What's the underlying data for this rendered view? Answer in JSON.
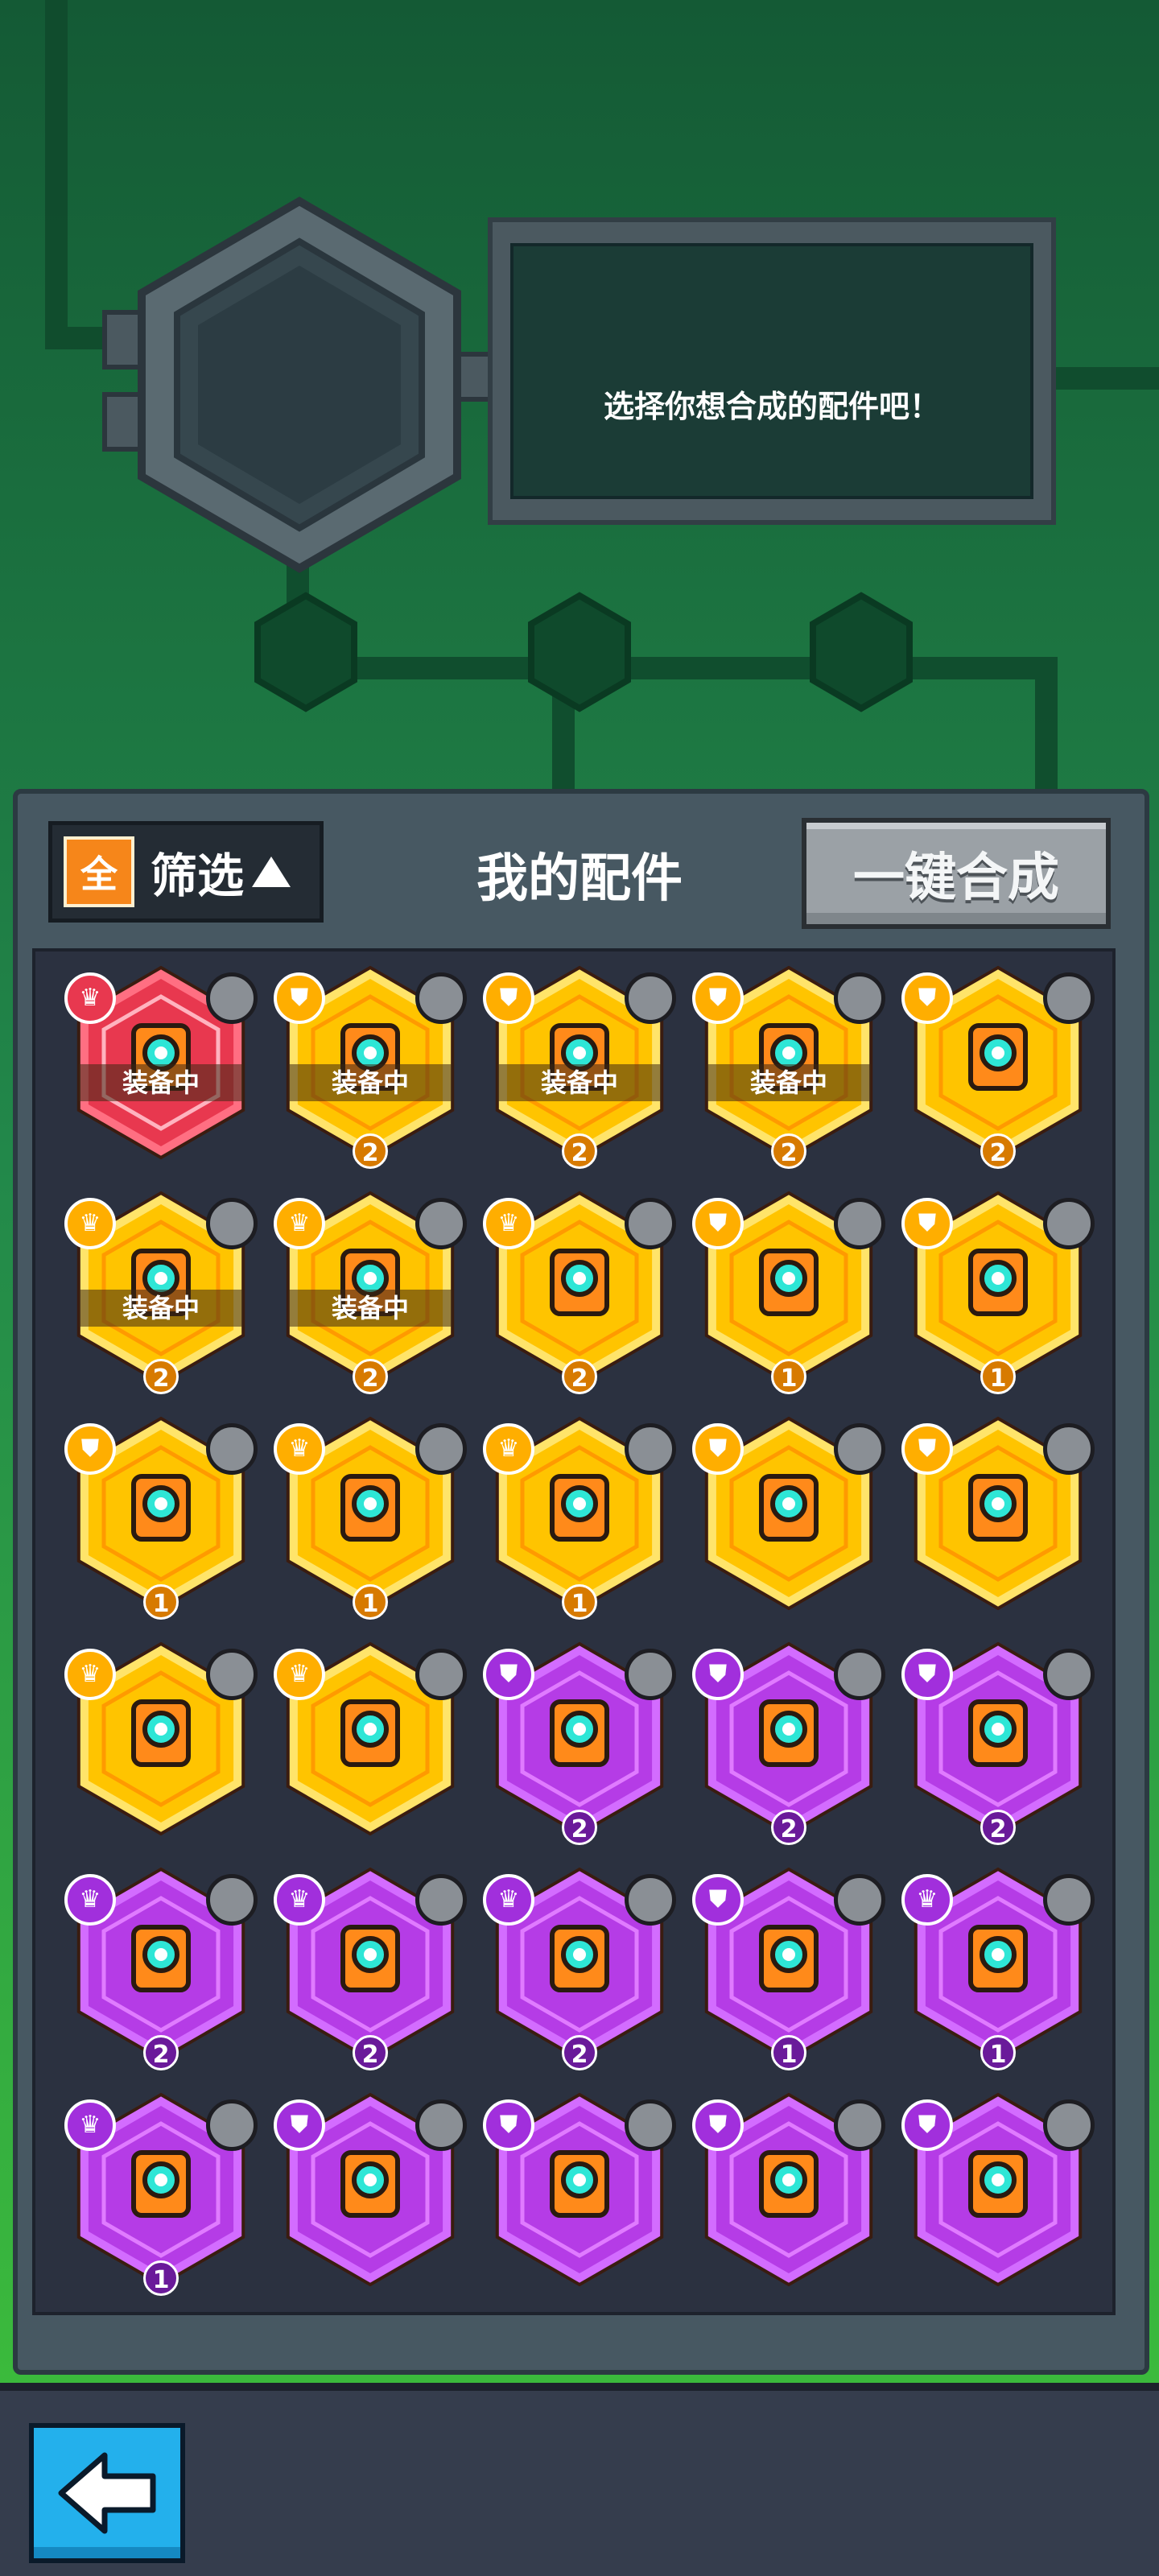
{
  "header": {
    "prompt_text": "选择你想合成的配件吧！"
  },
  "panel": {
    "filter_badge": "全",
    "filter_label": "筛选",
    "title": "我的配件",
    "merge_button": "一键合成"
  },
  "colors": {
    "legendary_red": "#e8384f",
    "epic_gold": "#ffc400",
    "rare_purple": "#b53ce6",
    "accent_orange": "#f6861a",
    "back_button": "#23b0ec"
  },
  "parts": [
    {
      "rarity": "red",
      "part": "eye-turret-icon",
      "role": "crown",
      "sub": "camera-icon",
      "equipped": "装备中",
      "level": ""
    },
    {
      "rarity": "gold",
      "part": "boot-armor-icon",
      "role": "shield",
      "sub": "watermelon-icon",
      "equipped": "装备中",
      "level": "2"
    },
    {
      "rarity": "gold",
      "part": "belt-armor-icon",
      "role": "shield",
      "sub": "target-icon",
      "equipped": "装备中",
      "level": "2"
    },
    {
      "rarity": "gold",
      "part": "helmet-icon",
      "role": "shield",
      "sub": "brick-icon",
      "equipped": "装备中",
      "level": "2"
    },
    {
      "rarity": "gold",
      "part": "speaker-icon",
      "role": "shield",
      "sub": "boomerang-icon",
      "equipped": "",
      "level": "2"
    },
    {
      "rarity": "gold",
      "part": "printer-body-icon",
      "role": "crown",
      "sub": "cone-icon",
      "equipped": "装备中",
      "level": "2"
    },
    {
      "rarity": "gold",
      "part": "lens-core-icon",
      "role": "crown",
      "sub": "soccer-ball-icon",
      "equipped": "装备中",
      "level": "2"
    },
    {
      "rarity": "gold",
      "part": "triangle-core-icon",
      "role": "crown",
      "sub": "bottle-icon",
      "equipped": "",
      "level": "2"
    },
    {
      "rarity": "gold",
      "part": "shoulder-plate-icon",
      "role": "shield",
      "sub": "rocket-icon",
      "equipped": "",
      "level": "1"
    },
    {
      "rarity": "gold",
      "part": "head-unit-icon",
      "role": "shield",
      "sub": "brick-icon",
      "equipped": "",
      "level": "1"
    },
    {
      "rarity": "gold",
      "part": "walker-drone-icon",
      "role": "shield",
      "sub": "spiky-ball-icon",
      "equipped": "",
      "level": "1"
    },
    {
      "rarity": "gold",
      "part": "turret-base-icon",
      "role": "crown",
      "sub": "drill-icon",
      "equipped": "",
      "level": "1"
    },
    {
      "rarity": "gold",
      "part": "leg-armor-icon",
      "role": "crown",
      "sub": "dice-icon",
      "equipped": "",
      "level": "1"
    },
    {
      "rarity": "gold",
      "part": "shoulder-plate-icon",
      "role": "shield",
      "sub": "rocket-icon",
      "equipped": "",
      "level": ""
    },
    {
      "rarity": "gold",
      "part": "walker-drone-icon",
      "role": "shield",
      "sub": "spiky-ball-icon",
      "equipped": "",
      "level": ""
    },
    {
      "rarity": "gold",
      "part": "printer-body-icon",
      "role": "crown",
      "sub": "cone-icon",
      "equipped": "",
      "level": ""
    },
    {
      "rarity": "gold",
      "part": "leg-armor-icon",
      "role": "crown",
      "sub": "dice-icon",
      "equipped": "",
      "level": ""
    },
    {
      "rarity": "purple",
      "part": "chest-plate-icon",
      "role": "shield",
      "sub": "rocket-icon",
      "equipped": "",
      "level": "2"
    },
    {
      "rarity": "purple",
      "part": "capsule-icon",
      "role": "shield",
      "sub": "watermelon-icon",
      "equipped": "",
      "level": "2"
    },
    {
      "rarity": "purple",
      "part": "monitor-bot-icon",
      "role": "shield",
      "sub": "brick-icon",
      "equipped": "",
      "level": "2"
    },
    {
      "rarity": "purple",
      "part": "cannon-mount-icon",
      "role": "crown",
      "sub": "drill-icon",
      "equipped": "",
      "level": "2"
    },
    {
      "rarity": "purple",
      "part": "lens-core-icon",
      "role": "crown",
      "sub": "soccer-ball-icon",
      "equipped": "",
      "level": "2"
    },
    {
      "rarity": "purple",
      "part": "leg-armor-icon",
      "role": "crown",
      "sub": "dice-icon",
      "equipped": "",
      "level": "2"
    },
    {
      "rarity": "purple",
      "part": "speaker-icon",
      "role": "shield",
      "sub": "boomerang-icon",
      "equipped": "",
      "level": "1"
    },
    {
      "rarity": "purple",
      "part": "cannon-mount-icon",
      "role": "crown",
      "sub": "drill-icon",
      "equipped": "",
      "level": "1"
    },
    {
      "rarity": "purple",
      "part": "lens-core-icon",
      "role": "crown",
      "sub": "soccer-ball-icon",
      "equipped": "",
      "level": "1"
    },
    {
      "rarity": "purple",
      "part": "chest-plate-icon",
      "role": "shield",
      "sub": "rocket-icon",
      "equipped": "",
      "level": ""
    },
    {
      "rarity": "purple",
      "part": "capsule-icon",
      "role": "shield",
      "sub": "watermelon-icon",
      "equipped": "",
      "level": ""
    },
    {
      "rarity": "purple",
      "part": "monitor-bot-icon",
      "role": "shield",
      "sub": "brick-icon",
      "equipped": "",
      "level": ""
    },
    {
      "rarity": "purple",
      "part": "speaker-icon",
      "role": "shield",
      "sub": "boomerang-icon",
      "equipped": "",
      "level": ""
    }
  ]
}
